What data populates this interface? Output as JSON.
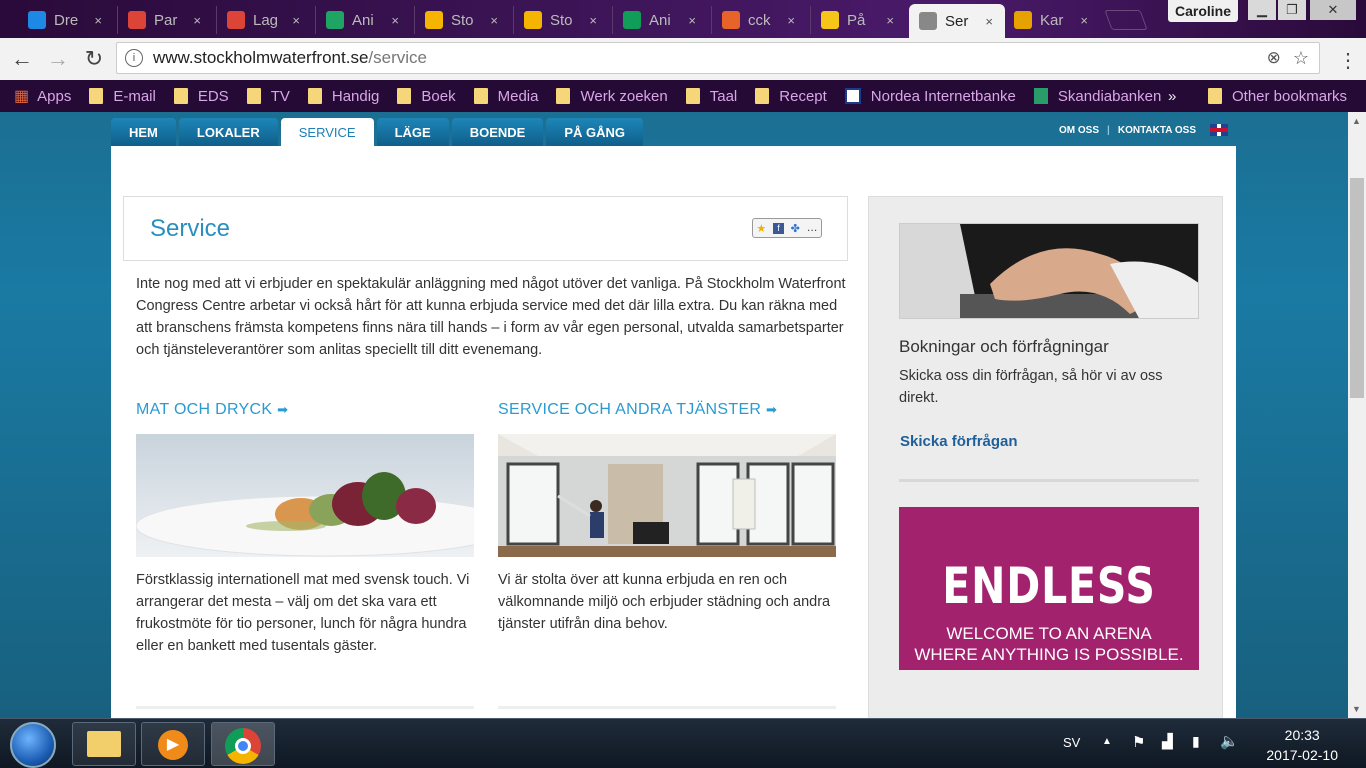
{
  "tabs": [
    {
      "label": "Dre",
      "color": "#1e88e5"
    },
    {
      "label": "Par",
      "color": "#db4437"
    },
    {
      "label": "Lag",
      "color": "#db4437"
    },
    {
      "label": "Ani",
      "color": "#1fa463"
    },
    {
      "label": "Sto",
      "color": "#f4b400"
    },
    {
      "label": "Sto",
      "color": "#f4b400"
    },
    {
      "label": "Ani",
      "color": "#0f9d58"
    },
    {
      "label": "cck",
      "color": "#e8632a"
    },
    {
      "label": "På",
      "color": "#f5c518"
    },
    {
      "label": "Ser",
      "color": "#888888",
      "active": true
    },
    {
      "label": "Kar",
      "color": "#e8a200"
    }
  ],
  "tab_close": "×",
  "profile_name": "Caroline",
  "url": {
    "domain": "www.stockholmwaterfront.se",
    "path": "/service"
  },
  "bookmarks": [
    {
      "label": "Apps"
    },
    {
      "label": "E-mail"
    },
    {
      "label": "EDS"
    },
    {
      "label": "TV"
    },
    {
      "label": "Handig"
    },
    {
      "label": "Boek"
    },
    {
      "label": "Media"
    },
    {
      "label": "Werk zoeken"
    },
    {
      "label": "Taal"
    },
    {
      "label": "Recept"
    },
    {
      "label": "Nordea Internetbanke"
    },
    {
      "label": "Skandiabanken"
    }
  ],
  "bookmarks_more": "»",
  "bookmarks_other": "Other bookmarks",
  "site_nav": [
    "HEM",
    "LOKALER",
    "SERVICE",
    "LÄGE",
    "BOENDE",
    "PÅ GÅNG"
  ],
  "site_nav_selected": "SERVICE",
  "top_links": [
    "OM OSS",
    "KONTAKTA OSS"
  ],
  "service_title": "Service",
  "intro": "Inte nog med att vi erbjuder en spektakulär anläggning med något utöver det vanliga. På Stockholm Waterfront Congress Centre arbetar vi också hårt för att kunna erbjuda service med det där lilla extra. Du kan räkna med att branschens främsta kompetens finns nära till hands – i form av vår egen personal, utvalda samarbetsparter och tjänsteleverantörer som anlitas speciellt till ditt evenemang.",
  "col1": {
    "heading": "MAT OCH DRYCK",
    "text": "Förstklassig internationell mat med svensk touch. Vi arrangerar det mesta – välj om det ska vara ett frukostmöte för tio personer, lunch för några hundra eller en bankett med tusentals gäster."
  },
  "col2": {
    "heading": "SERVICE OCH ANDRA TJÄNSTER",
    "text": "Vi är stolta över att kunna erbjuda en ren och välkomnande miljö och erbjuder städning och andra tjänster utifrån dina behov."
  },
  "sidebar": {
    "heading": "Bokningar och förfrågningar",
    "text": "Skicka oss din förfrågan, så hör vi av oss direkt.",
    "link": "Skicka förfrågan"
  },
  "banner": {
    "big": "ENDLESS",
    "line1": "WELCOME TO AN ARENA",
    "line2": "WHERE ANYTHING IS POSSIBLE."
  },
  "taskbar": {
    "lang": "SV",
    "time": "20:33",
    "date": "2017-02-10"
  }
}
